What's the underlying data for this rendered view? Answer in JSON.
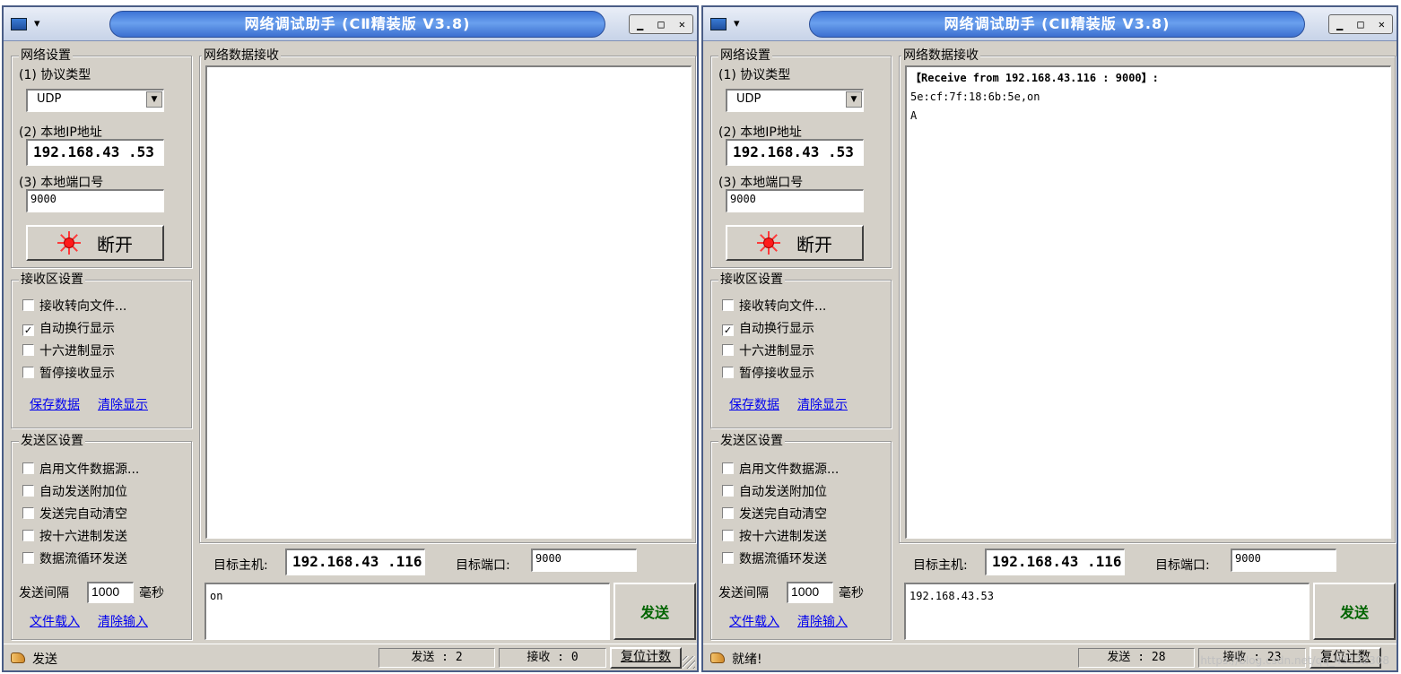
{
  "windows": [
    {
      "title": "网络调试助手 (CⅡ精装版 V3.8)",
      "network_settings": {
        "group_label": "网络设置",
        "protocol_label": "(1) 协议类型",
        "protocol_value": "UDP",
        "local_ip_label": "(2) 本地IP地址",
        "local_ip_value": "192.168.43 .53",
        "local_port_label": "(3) 本地端口号",
        "local_port_value": "9000",
        "connect_button": "断开"
      },
      "receive_settings": {
        "group_label": "接收区设置",
        "options": [
          {
            "label": "接收转向文件...",
            "checked": false
          },
          {
            "label": "自动换行显示",
            "checked": true
          },
          {
            "label": "十六进制显示",
            "checked": false
          },
          {
            "label": "暂停接收显示",
            "checked": false
          }
        ],
        "save_link": "保存数据",
        "clear_link": "清除显示"
      },
      "send_settings": {
        "group_label": "发送区设置",
        "options": [
          {
            "label": "启用文件数据源...",
            "checked": false
          },
          {
            "label": "自动发送附加位",
            "checked": false
          },
          {
            "label": "发送完自动清空",
            "checked": false
          },
          {
            "label": "按十六进制发送",
            "checked": false
          },
          {
            "label": "数据流循环发送",
            "checked": false
          }
        ],
        "interval_label": "发送间隔",
        "interval_value": "1000",
        "interval_unit": "毫秒",
        "load_file_link": "文件载入",
        "clear_input_link": "清除输入"
      },
      "receive_area": {
        "group_label": "网络数据接收",
        "lines": [
          "",
          "",
          ""
        ]
      },
      "target": {
        "host_label": "目标主机:",
        "host_value": "192.168.43 .116",
        "port_label": "目标端口:",
        "port_value": "9000"
      },
      "send_input": "on",
      "send_button": "发送",
      "status": {
        "text": "发送",
        "sent": "发送 : 2",
        "received": "接收 : 0",
        "reset": "复位计数"
      }
    },
    {
      "title": "网络调试助手 (CⅡ精装版 V3.8)",
      "network_settings": {
        "group_label": "网络设置",
        "protocol_label": "(1) 协议类型",
        "protocol_value": "UDP",
        "local_ip_label": "(2) 本地IP地址",
        "local_ip_value": "192.168.43 .53",
        "local_port_label": "(3) 本地端口号",
        "local_port_value": "9000",
        "connect_button": "断开"
      },
      "receive_settings": {
        "group_label": "接收区设置",
        "options": [
          {
            "label": "接收转向文件...",
            "checked": false
          },
          {
            "label": "自动换行显示",
            "checked": true
          },
          {
            "label": "十六进制显示",
            "checked": false
          },
          {
            "label": "暂停接收显示",
            "checked": false
          }
        ],
        "save_link": "保存数据",
        "clear_link": "清除显示"
      },
      "send_settings": {
        "group_label": "发送区设置",
        "options": [
          {
            "label": "启用文件数据源...",
            "checked": false
          },
          {
            "label": "自动发送附加位",
            "checked": false
          },
          {
            "label": "发送完自动清空",
            "checked": false
          },
          {
            "label": "按十六进制发送",
            "checked": false
          },
          {
            "label": "数据流循环发送",
            "checked": false
          }
        ],
        "interval_label": "发送间隔",
        "interval_value": "1000",
        "interval_unit": "毫秒",
        "load_file_link": "文件载入",
        "clear_input_link": "清除输入"
      },
      "receive_area": {
        "group_label": "网络数据接收",
        "lines": [
          "【Receive from 192.168.43.116 : 9000】:",
          "5e:cf:7f:18:6b:5e,on",
          "A"
        ]
      },
      "target": {
        "host_label": "目标主机:",
        "host_value": "192.168.43 .116",
        "port_label": "目标端口:",
        "port_value": "9000"
      },
      "send_input": "192.168.43.53",
      "send_button": "发送",
      "status": {
        "text": "就绪!",
        "sent": "发送 : 28",
        "received": "接收 : 23",
        "reset": "复位计数"
      }
    }
  ],
  "watermark": "https://blog.csdn.net/qq_43132308",
  "colors": {
    "window_bg": "#d4d0c8",
    "title_blue": "#3d74d6",
    "link_blue": "#0000ee",
    "send_green": "#006400",
    "indicator_red": "#ff1a1a"
  }
}
